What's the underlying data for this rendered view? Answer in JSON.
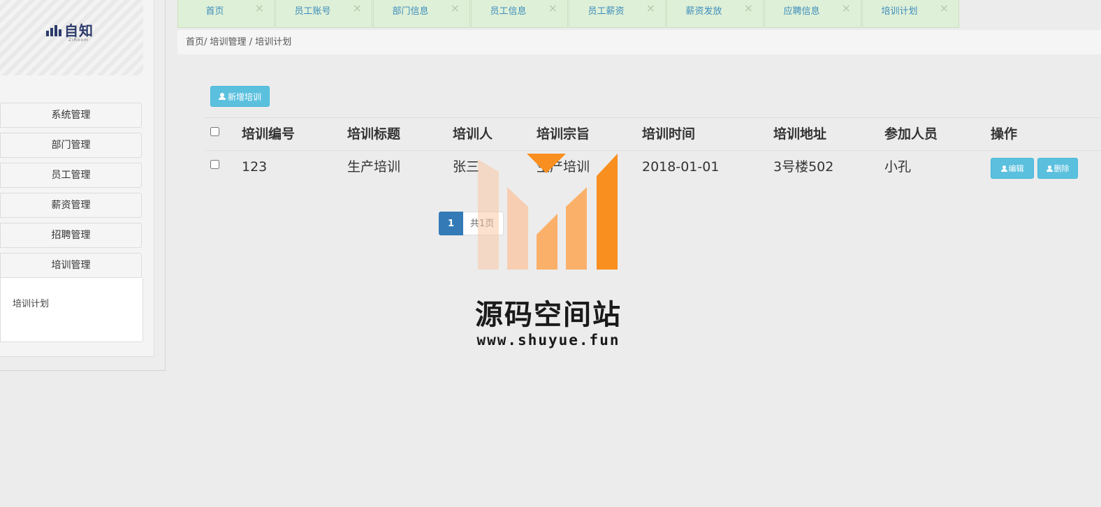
{
  "app": {
    "logo_text": "自知",
    "logo_sub": "ZiRoom"
  },
  "sidebar": {
    "menu": [
      {
        "label": "系统管理"
      },
      {
        "label": "部门管理"
      },
      {
        "label": "员工管理"
      },
      {
        "label": "薪资管理"
      },
      {
        "label": "招聘管理"
      },
      {
        "label": "培训管理"
      }
    ],
    "submenu": [
      {
        "label": "培训计划"
      }
    ]
  },
  "tabs": [
    {
      "label": "首页",
      "close": "×"
    },
    {
      "label": "员工账号",
      "close": "×"
    },
    {
      "label": "部门信息",
      "close": "×"
    },
    {
      "label": "员工信息",
      "close": "×"
    },
    {
      "label": "员工薪资",
      "close": "×"
    },
    {
      "label": "薪资发放",
      "close": "×"
    },
    {
      "label": "应聘信息",
      "close": "×"
    },
    {
      "label": "培训计划",
      "close": "×"
    }
  ],
  "breadcrumb": {
    "home": "首页/",
    "section": "培训管理",
    "sep": "/",
    "current": "培训计划"
  },
  "toolbar": {
    "add_label": "新增培训"
  },
  "table": {
    "headers": [
      "培训编号",
      "培训标题",
      "培训人",
      "培训宗旨",
      "培训时间",
      "培训地址",
      "参加人员",
      "操作"
    ],
    "rows": [
      {
        "id": "123",
        "title": "生产培训",
        "trainer": "张三",
        "purpose": "生产培训",
        "time": "2018-01-01",
        "address": "3号楼502",
        "participants": "小孔",
        "edit_label": "编辑",
        "delete_label": "删除"
      }
    ]
  },
  "pagination": {
    "current_page": "1",
    "total_text": "共1页"
  },
  "watermark": {
    "title": "源码空间站",
    "url": "www.shuyue.fun",
    "colors": [
      "#f9c9a8",
      "#fbb06a",
      "#f98f1f"
    ]
  }
}
